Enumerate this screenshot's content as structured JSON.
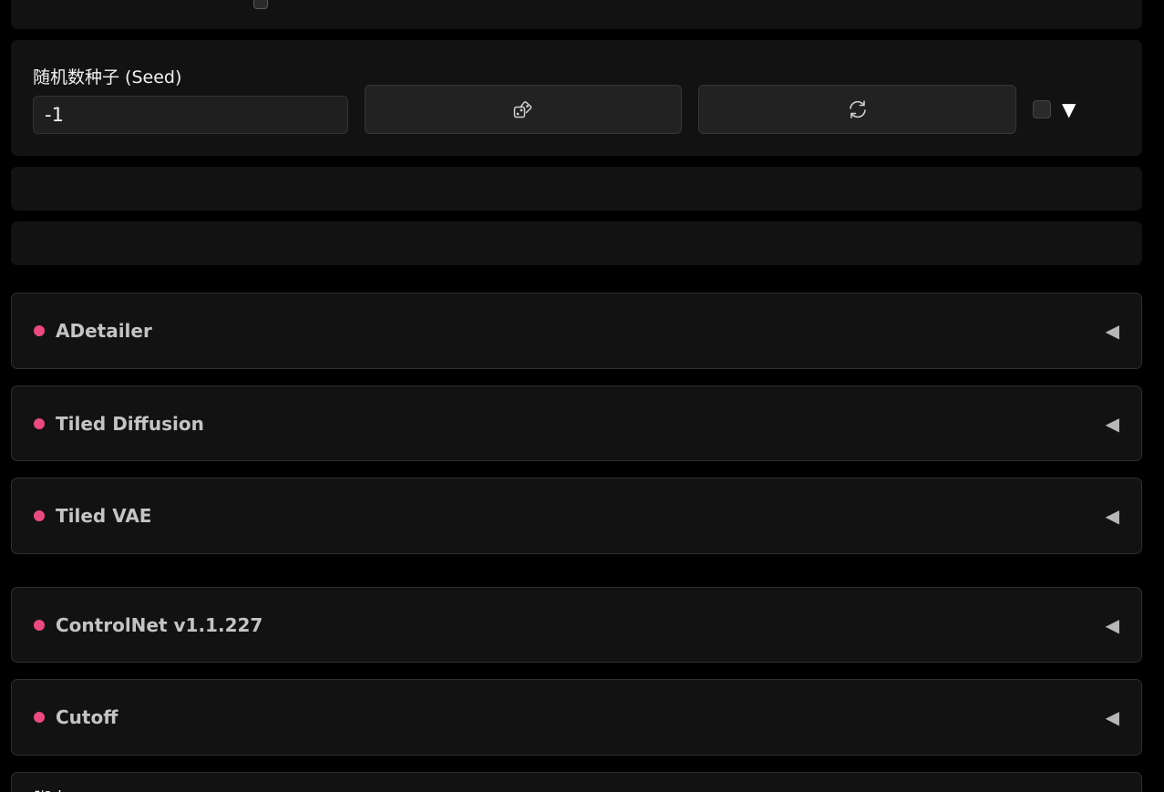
{
  "seed": {
    "label": "随机数种子 (Seed)",
    "value": "-1",
    "extra_toggle_glyph": "▼",
    "dice_icon": "dice-icon",
    "reuse_icon": "recycle-icon"
  },
  "accordions": [
    {
      "title": "ADetailer",
      "chevron": "◀"
    },
    {
      "title": "Tiled Diffusion",
      "chevron": "◀"
    },
    {
      "title": "Tiled VAE",
      "chevron": "◀"
    },
    {
      "title": "ControlNet v1.1.227",
      "chevron": "◀"
    },
    {
      "title": "Cutoff",
      "chevron": "◀"
    }
  ],
  "script": {
    "label": "脚本"
  },
  "colors": {
    "accent_dot": "#ec4a7e",
    "panel_bg": "#121212",
    "page_bg": "#000000"
  }
}
